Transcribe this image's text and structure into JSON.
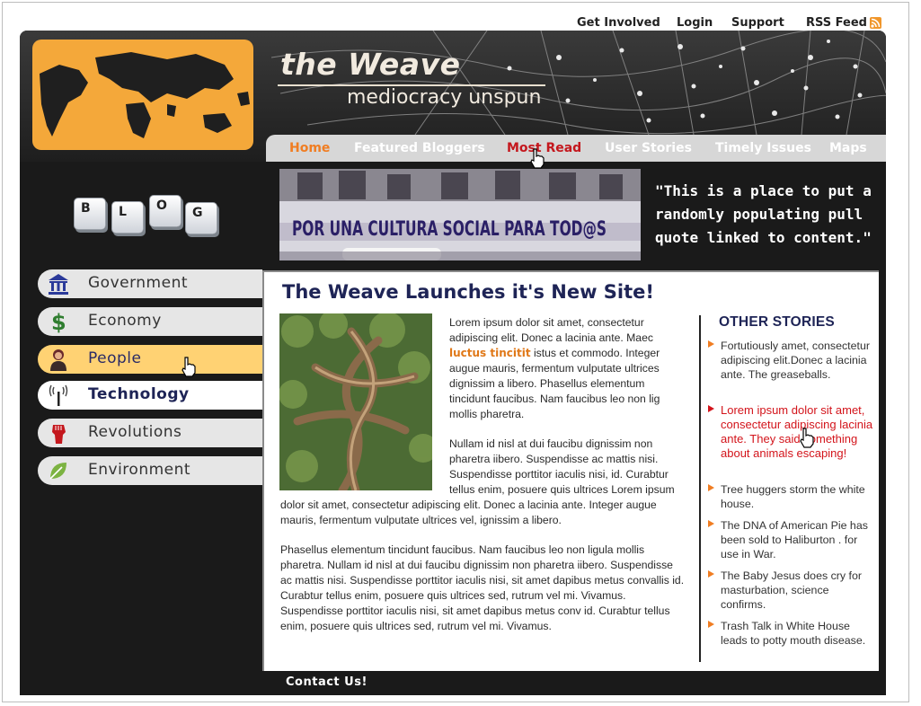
{
  "top_links": {
    "get_involved": "Get Involved",
    "login": "Login",
    "support": "Support",
    "rss": "RSS Feed"
  },
  "header": {
    "title": "the Weave",
    "tagline": "mediocracy unspun"
  },
  "nav": {
    "items": [
      "Home",
      "Featured Bloggers",
      "Most Read",
      "User Stories",
      "Timely Issues",
      "Maps"
    ]
  },
  "banner": {
    "graffiti_text": "POR UNA CULTURA SOCIAL PARA TOD@S",
    "quote": "\"This is a place to put a randomly populating pull quote linked to content.\""
  },
  "blog_keys": [
    "B",
    "L",
    "O",
    "G"
  ],
  "sidebar": {
    "items": [
      {
        "label": "Government",
        "icon": "government-building-icon"
      },
      {
        "label": "Economy",
        "icon": "dollar-icon"
      },
      {
        "label": "People",
        "icon": "person-icon"
      },
      {
        "label": "Technology",
        "icon": "antenna-icon"
      },
      {
        "label": "Revolutions",
        "icon": "raised-fist-icon"
      },
      {
        "label": "Environment",
        "icon": "leaf-icon"
      }
    ]
  },
  "article": {
    "headline": "The Weave Launches it's New Site!",
    "p1_before": "Lorem ipsum dolor sit amet, consectetur adipiscing elit. Donec a lacinia ante. Maec ",
    "p1_link": "luctus tincitit",
    "p1_after": "  istus et commodo. Integer augue mauris, fermentum vulputate ultrices dignissim a libero. Phasellus elementum tincidunt faucibus. Nam faucibus leo non lig mollis pharetra.",
    "p2": "Nullam id nisl at dui faucibu dignissim non pharetra  iibero. Suspendisse ac mattis nisi. Suspendisse porttitor iaculis nisi, id. Curabtur tellus enim, posuere quis ultrices Lorem ipsum dolor sit amet, consectetur  adipiscing elit. Donec a lacinia ante. Integer augue mauris, fermentum vulputate ultrices vel, ignissim a libero.",
    "p3": "Phasellus elementum tincidunt faucibus. Nam faucibus leo non ligula mollis pharetra. Nullam id nisl at dui faucibu dignissim non pharetra  iibero. Suspendisse ac mattis nisi. Suspendisse porttitor iaculis nisi, sit amet dapibus metus convallis id. Curabtur tellus enim, posuere quis ultrices sed, rutrum vel mi. Vivamus.  Suspendisse porttitor iaculis nisi, sit amet dapibus metus conv id. Curabtur tellus enim, posuere quis ultrices sed, rutrum vel mi. Vivamus."
  },
  "other_stories": {
    "title": "OTHER STORIES",
    "items": [
      "Fortutiously amet, consectetur adipiscing elit.Donec a lacinia ante. The greaseballs.",
      "Lorem ipsum dolor sit amet, consectetur adipiscing lacinia ante. They said something about animals escaping!",
      "Tree huggers storm the white house.",
      "The DNA of American Pie has been sold to Haliburton . for use in War.",
      "The Baby Jesus does cry for masturbation, science confirms.",
      "Trash Talk in White House leads to potty mouth disease."
    ]
  },
  "footer": {
    "contact": "Contact Us!"
  },
  "colors": {
    "accent_orange": "#f07d22",
    "navy": "#1e2456",
    "alert_red": "#d3141b",
    "dark_bg": "#1a1a1a",
    "highlight": "#ffd273"
  }
}
